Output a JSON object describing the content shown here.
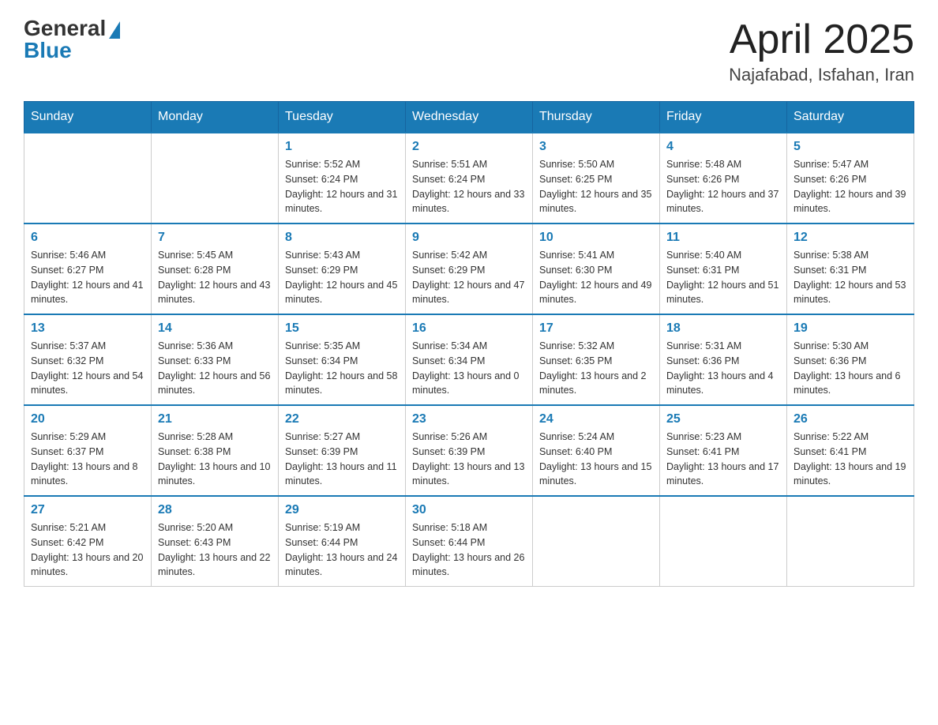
{
  "header": {
    "logo_general": "General",
    "logo_blue": "Blue",
    "month_year": "April 2025",
    "location": "Najafabad, Isfahan, Iran"
  },
  "days_of_week": [
    "Sunday",
    "Monday",
    "Tuesday",
    "Wednesday",
    "Thursday",
    "Friday",
    "Saturday"
  ],
  "weeks": [
    [
      {
        "day": "",
        "sunrise": "",
        "sunset": "",
        "daylight": ""
      },
      {
        "day": "",
        "sunrise": "",
        "sunset": "",
        "daylight": ""
      },
      {
        "day": "1",
        "sunrise": "Sunrise: 5:52 AM",
        "sunset": "Sunset: 6:24 PM",
        "daylight": "Daylight: 12 hours and 31 minutes."
      },
      {
        "day": "2",
        "sunrise": "Sunrise: 5:51 AM",
        "sunset": "Sunset: 6:24 PM",
        "daylight": "Daylight: 12 hours and 33 minutes."
      },
      {
        "day": "3",
        "sunrise": "Sunrise: 5:50 AM",
        "sunset": "Sunset: 6:25 PM",
        "daylight": "Daylight: 12 hours and 35 minutes."
      },
      {
        "day": "4",
        "sunrise": "Sunrise: 5:48 AM",
        "sunset": "Sunset: 6:26 PM",
        "daylight": "Daylight: 12 hours and 37 minutes."
      },
      {
        "day": "5",
        "sunrise": "Sunrise: 5:47 AM",
        "sunset": "Sunset: 6:26 PM",
        "daylight": "Daylight: 12 hours and 39 minutes."
      }
    ],
    [
      {
        "day": "6",
        "sunrise": "Sunrise: 5:46 AM",
        "sunset": "Sunset: 6:27 PM",
        "daylight": "Daylight: 12 hours and 41 minutes."
      },
      {
        "day": "7",
        "sunrise": "Sunrise: 5:45 AM",
        "sunset": "Sunset: 6:28 PM",
        "daylight": "Daylight: 12 hours and 43 minutes."
      },
      {
        "day": "8",
        "sunrise": "Sunrise: 5:43 AM",
        "sunset": "Sunset: 6:29 PM",
        "daylight": "Daylight: 12 hours and 45 minutes."
      },
      {
        "day": "9",
        "sunrise": "Sunrise: 5:42 AM",
        "sunset": "Sunset: 6:29 PM",
        "daylight": "Daylight: 12 hours and 47 minutes."
      },
      {
        "day": "10",
        "sunrise": "Sunrise: 5:41 AM",
        "sunset": "Sunset: 6:30 PM",
        "daylight": "Daylight: 12 hours and 49 minutes."
      },
      {
        "day": "11",
        "sunrise": "Sunrise: 5:40 AM",
        "sunset": "Sunset: 6:31 PM",
        "daylight": "Daylight: 12 hours and 51 minutes."
      },
      {
        "day": "12",
        "sunrise": "Sunrise: 5:38 AM",
        "sunset": "Sunset: 6:31 PM",
        "daylight": "Daylight: 12 hours and 53 minutes."
      }
    ],
    [
      {
        "day": "13",
        "sunrise": "Sunrise: 5:37 AM",
        "sunset": "Sunset: 6:32 PM",
        "daylight": "Daylight: 12 hours and 54 minutes."
      },
      {
        "day": "14",
        "sunrise": "Sunrise: 5:36 AM",
        "sunset": "Sunset: 6:33 PM",
        "daylight": "Daylight: 12 hours and 56 minutes."
      },
      {
        "day": "15",
        "sunrise": "Sunrise: 5:35 AM",
        "sunset": "Sunset: 6:34 PM",
        "daylight": "Daylight: 12 hours and 58 minutes."
      },
      {
        "day": "16",
        "sunrise": "Sunrise: 5:34 AM",
        "sunset": "Sunset: 6:34 PM",
        "daylight": "Daylight: 13 hours and 0 minutes."
      },
      {
        "day": "17",
        "sunrise": "Sunrise: 5:32 AM",
        "sunset": "Sunset: 6:35 PM",
        "daylight": "Daylight: 13 hours and 2 minutes."
      },
      {
        "day": "18",
        "sunrise": "Sunrise: 5:31 AM",
        "sunset": "Sunset: 6:36 PM",
        "daylight": "Daylight: 13 hours and 4 minutes."
      },
      {
        "day": "19",
        "sunrise": "Sunrise: 5:30 AM",
        "sunset": "Sunset: 6:36 PM",
        "daylight": "Daylight: 13 hours and 6 minutes."
      }
    ],
    [
      {
        "day": "20",
        "sunrise": "Sunrise: 5:29 AM",
        "sunset": "Sunset: 6:37 PM",
        "daylight": "Daylight: 13 hours and 8 minutes."
      },
      {
        "day": "21",
        "sunrise": "Sunrise: 5:28 AM",
        "sunset": "Sunset: 6:38 PM",
        "daylight": "Daylight: 13 hours and 10 minutes."
      },
      {
        "day": "22",
        "sunrise": "Sunrise: 5:27 AM",
        "sunset": "Sunset: 6:39 PM",
        "daylight": "Daylight: 13 hours and 11 minutes."
      },
      {
        "day": "23",
        "sunrise": "Sunrise: 5:26 AM",
        "sunset": "Sunset: 6:39 PM",
        "daylight": "Daylight: 13 hours and 13 minutes."
      },
      {
        "day": "24",
        "sunrise": "Sunrise: 5:24 AM",
        "sunset": "Sunset: 6:40 PM",
        "daylight": "Daylight: 13 hours and 15 minutes."
      },
      {
        "day": "25",
        "sunrise": "Sunrise: 5:23 AM",
        "sunset": "Sunset: 6:41 PM",
        "daylight": "Daylight: 13 hours and 17 minutes."
      },
      {
        "day": "26",
        "sunrise": "Sunrise: 5:22 AM",
        "sunset": "Sunset: 6:41 PM",
        "daylight": "Daylight: 13 hours and 19 minutes."
      }
    ],
    [
      {
        "day": "27",
        "sunrise": "Sunrise: 5:21 AM",
        "sunset": "Sunset: 6:42 PM",
        "daylight": "Daylight: 13 hours and 20 minutes."
      },
      {
        "day": "28",
        "sunrise": "Sunrise: 5:20 AM",
        "sunset": "Sunset: 6:43 PM",
        "daylight": "Daylight: 13 hours and 22 minutes."
      },
      {
        "day": "29",
        "sunrise": "Sunrise: 5:19 AM",
        "sunset": "Sunset: 6:44 PM",
        "daylight": "Daylight: 13 hours and 24 minutes."
      },
      {
        "day": "30",
        "sunrise": "Sunrise: 5:18 AM",
        "sunset": "Sunset: 6:44 PM",
        "daylight": "Daylight: 13 hours and 26 minutes."
      },
      {
        "day": "",
        "sunrise": "",
        "sunset": "",
        "daylight": ""
      },
      {
        "day": "",
        "sunrise": "",
        "sunset": "",
        "daylight": ""
      },
      {
        "day": "",
        "sunrise": "",
        "sunset": "",
        "daylight": ""
      }
    ]
  ]
}
